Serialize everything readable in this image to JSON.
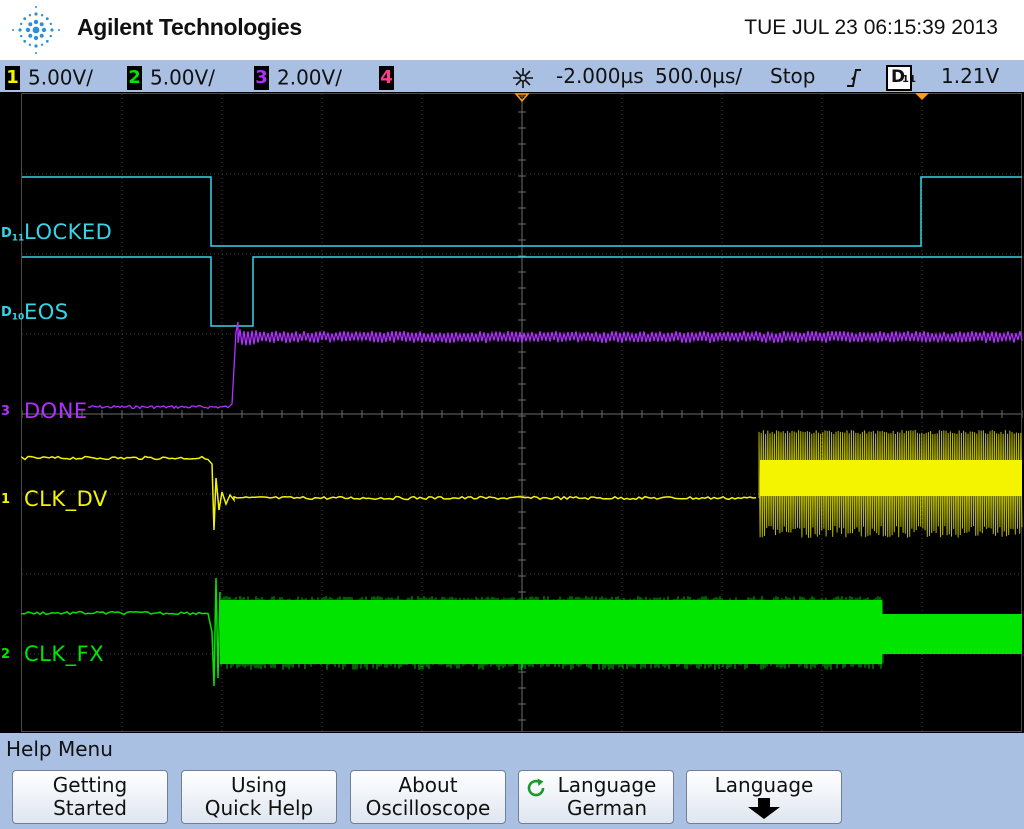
{
  "header": {
    "brand": "Agilent Technologies",
    "datetime": "TUE JUL 23 06:15:39 2013"
  },
  "status_bar": {
    "channels": [
      {
        "num": "1",
        "scale": "5.00V/",
        "color": "#f4f400"
      },
      {
        "num": "2",
        "scale": "5.00V/",
        "color": "#00e400"
      },
      {
        "num": "3",
        "scale": "2.00V/",
        "color": "#b030ff"
      },
      {
        "num": "4",
        "scale": "",
        "color": "#ff3c8c"
      }
    ],
    "trigger_position_icon": "trigger-position-icon",
    "horizontal_delay": "-2.000µs",
    "timebase": "500.0µs/",
    "run_state": "Stop",
    "trigger_slope_icon": "rising-edge-icon",
    "trigger_source": "D11",
    "trigger_level": "1.21V"
  },
  "traces": {
    "locked": {
      "name": "LOCKED",
      "marker": "D",
      "marker_sub": "11",
      "color": "#35d5e8"
    },
    "eos": {
      "name": "EOS",
      "marker": "D",
      "marker_sub": "10",
      "color": "#35d5e8"
    },
    "done": {
      "name": "DONE",
      "marker": "3",
      "color": "#b030ff"
    },
    "clk_dv": {
      "name": "CLK_DV",
      "marker": "1",
      "color": "#f4f400"
    },
    "clk_fx": {
      "name": "CLK_FX",
      "marker": "2",
      "color": "#00e400"
    }
  },
  "menu": {
    "title": "Help Menu",
    "softkeys": [
      {
        "line1": "Getting",
        "line2": "Started"
      },
      {
        "line1": "Using",
        "line2": "Quick Help"
      },
      {
        "line1": "About",
        "line2": "Oscilloscope"
      },
      {
        "line1": "Language",
        "line2": "German",
        "icon": "refresh-icon"
      },
      {
        "line1": "Language",
        "icon": "arrow-down-icon"
      }
    ]
  }
}
